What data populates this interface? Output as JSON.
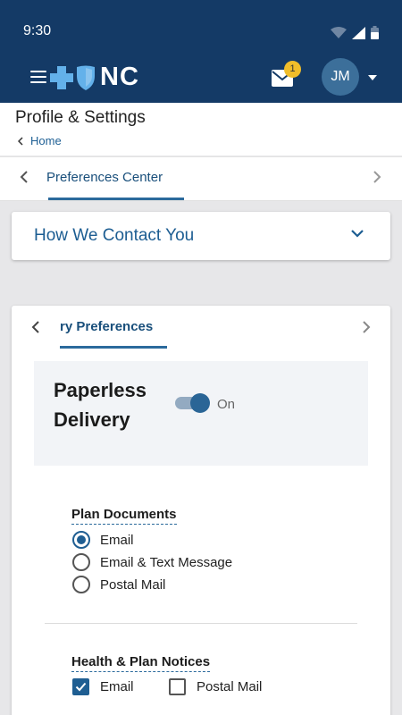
{
  "status_bar": {
    "time": "9:30"
  },
  "header": {
    "logo_text": "NC",
    "mail_badge_count": "1",
    "avatar_initials": "JM"
  },
  "page": {
    "title": "Profile & Settings",
    "breadcrumb": "Home"
  },
  "top_tab": {
    "label": "Preferences Center"
  },
  "accordion": {
    "title": "How We Contact You"
  },
  "card": {
    "tab_label": "ry Preferences",
    "paperless": {
      "title_line1": "Paperless",
      "title_line2": "Delivery",
      "toggle_label": "On",
      "toggle_on": true
    },
    "plan_documents": {
      "title": "Plan Documents",
      "options": [
        {
          "label": "Email",
          "checked": true
        },
        {
          "label": "Email & Text Message",
          "checked": false
        },
        {
          "label": "Postal Mail",
          "checked": false
        }
      ]
    },
    "health_notices": {
      "title": "Health & Plan Notices",
      "options": [
        {
          "label": "Email",
          "checked": true
        },
        {
          "label": "Postal Mail",
          "checked": false
        }
      ]
    }
  },
  "colors": {
    "header_bg": "#143a66",
    "accent": "#1f5e92",
    "badge": "#f0bd2a"
  }
}
